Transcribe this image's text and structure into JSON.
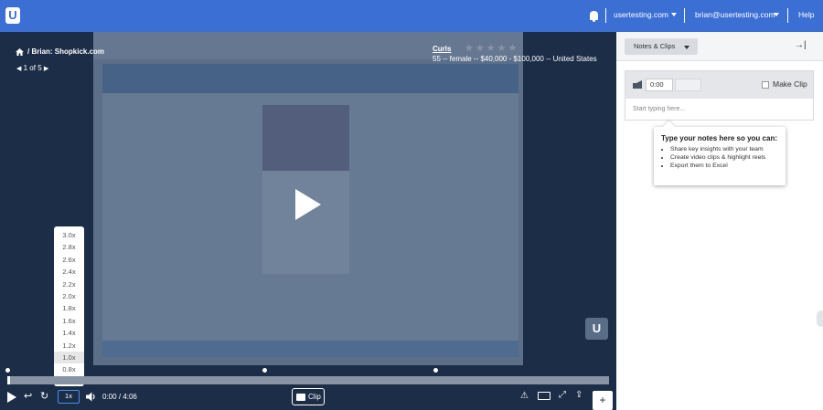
{
  "topbar": {
    "account": "usertesting.com",
    "user": "brian@usertesting.com",
    "help": "Help"
  },
  "breadcrumb": {
    "title": "Brian: Shopkick.com",
    "pager": "1 of 5"
  },
  "tester": {
    "name": "Curls",
    "details": "55 -- female -- $40,000 - $100,000 -- United States"
  },
  "speed_menu": {
    "options": [
      "3.0x",
      "2.8x",
      "2.6x",
      "2.4x",
      "2.2x",
      "2.0x",
      "1.8x",
      "1.6x",
      "1.4x",
      "1.2x",
      "1.0x",
      "0.8x",
      "0.5x"
    ],
    "selected": "1.0x"
  },
  "controls": {
    "speed": "1x",
    "current_time": "0:00",
    "separator": "/",
    "duration": "4:06",
    "clip_label": "Clip",
    "add_label": "+"
  },
  "panel": {
    "dropdown": "Notes & Clips",
    "collapse": "→|",
    "time_value": "0:00",
    "make_clip": "Make Clip",
    "placeholder": "Start typing here...",
    "tip_title": "Type your notes here so you can:",
    "tip_items": [
      "Share key insights with your team",
      "Create video clips & highlight reels",
      "Export them to Excel"
    ]
  },
  "colors": {
    "topbar": "#3b6fd4",
    "player_bg": "#1c2d47",
    "accent": "#4a8ef0"
  }
}
